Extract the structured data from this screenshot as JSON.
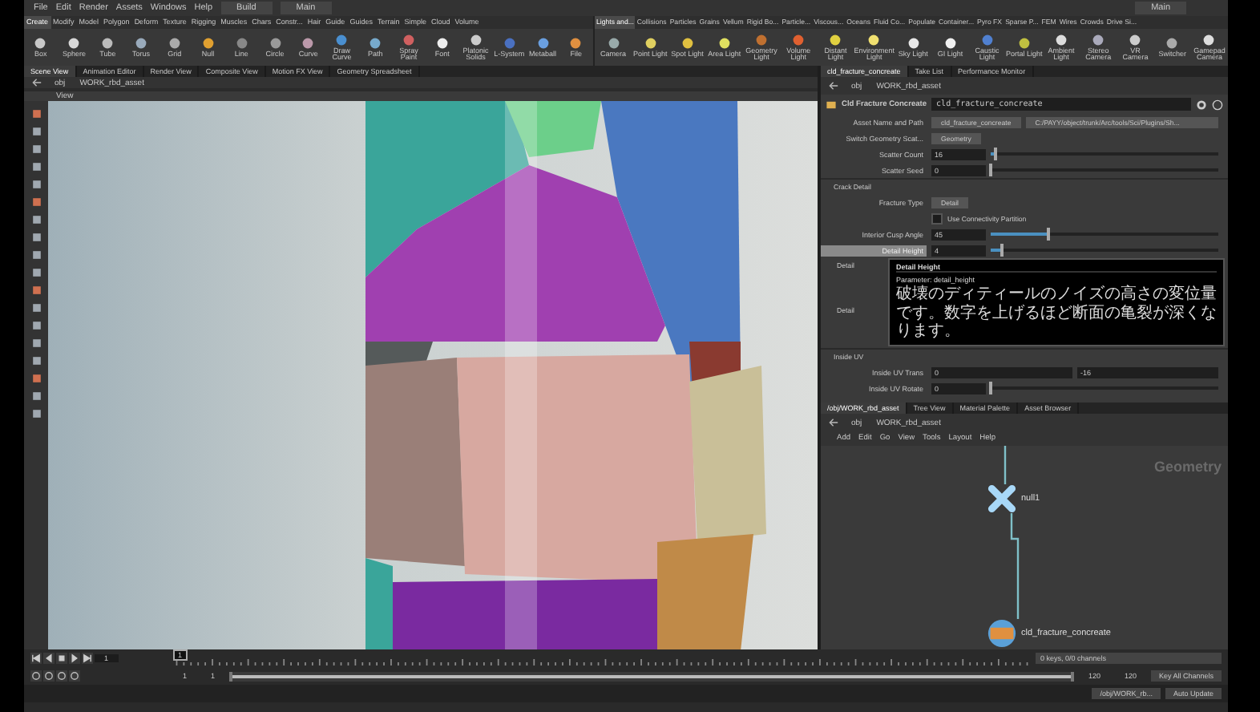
{
  "menu_bar": {
    "items": [
      "File",
      "Edit",
      "Render",
      "Assets",
      "Windows",
      "Help"
    ],
    "desktop": "Build",
    "context": "Main",
    "desktop_right": "Main"
  },
  "shelf_tabs": [
    {
      "label": "Create",
      "selected": true
    },
    {
      "label": "Modify",
      "selected": false
    },
    {
      "label": "Model",
      "selected": false
    },
    {
      "label": "Polygon",
      "selected": false
    },
    {
      "label": "Deform",
      "selected": false
    },
    {
      "label": "Texture",
      "selected": false
    },
    {
      "label": "Rigging",
      "selected": false
    },
    {
      "label": "Muscles",
      "selected": false
    },
    {
      "label": "Chars",
      "selected": false
    },
    {
      "label": "Constr...",
      "selected": false
    },
    {
      "label": "Hair",
      "selected": false
    },
    {
      "label": "Guide",
      "selected": false
    },
    {
      "label": "Guides",
      "selected": false
    },
    {
      "label": "Terrain",
      "selected": false
    },
    {
      "label": "Simple",
      "selected": false
    },
    {
      "label": "Cloud",
      "selected": false
    },
    {
      "label": "Volume",
      "selected": false
    }
  ],
  "shelf_tools": [
    "Box",
    "Sphere",
    "Tube",
    "Torus",
    "Grid",
    "Null",
    "Line",
    "Circle",
    "Curve",
    "Draw Curve",
    "Path",
    "Spray Paint",
    "Font",
    "Platonic Solids",
    "L-System",
    "Metaball",
    "File"
  ],
  "shelf_tabs_right": [
    {
      "label": "Lights and...",
      "selected": true
    },
    {
      "label": "Collisions",
      "selected": false
    },
    {
      "label": "Particles",
      "selected": false
    },
    {
      "label": "Grains",
      "selected": false
    },
    {
      "label": "Vellum",
      "selected": false
    },
    {
      "label": "Rigid Bo...",
      "selected": false
    },
    {
      "label": "Particle...",
      "selected": false
    },
    {
      "label": "Viscous...",
      "selected": false
    },
    {
      "label": "Oceans",
      "selected": false
    },
    {
      "label": "Fluid Co...",
      "selected": false
    },
    {
      "label": "Populate",
      "selected": false
    },
    {
      "label": "Container...",
      "selected": false
    },
    {
      "label": "Pyro FX",
      "selected": false
    },
    {
      "label": "Sparse P...",
      "selected": false
    },
    {
      "label": "FEM",
      "selected": false
    },
    {
      "label": "Wires",
      "selected": false
    },
    {
      "label": "Crowds",
      "selected": false
    },
    {
      "label": "Drive Si...",
      "selected": false
    }
  ],
  "shelf_tools_right": [
    "Camera",
    "Point Light",
    "Spot Light",
    "Area Light",
    "Geometry Light",
    "Volume Light",
    "Distant Light",
    "Environment Light",
    "Sky Light",
    "GI Light",
    "Caustic Light",
    "Portal Light",
    "Ambient Light",
    "Stereo Camera",
    "VR Camera",
    "Switcher",
    "Gamepad Camera"
  ],
  "left_pane": {
    "tabs": [
      {
        "label": "Scene View",
        "selected": true
      },
      {
        "label": "Animation Editor",
        "selected": false
      },
      {
        "label": "Render View",
        "selected": false
      },
      {
        "label": "Composite View",
        "selected": false
      },
      {
        "label": "Motion FX View",
        "selected": false
      },
      {
        "label": "Geometry Spreadsheet",
        "selected": false
      }
    ],
    "path": [
      "obj",
      "WORK_rbd_asset"
    ],
    "viewport_title": "View"
  },
  "parameter_pane": {
    "tabs": [
      {
        "label": "cld_fracture_concreate",
        "selected": true
      },
      {
        "label": "Take List",
        "selected": false
      },
      {
        "label": "Performance Monitor",
        "selected": false
      }
    ],
    "path": [
      "obj",
      "WORK_rbd_asset"
    ],
    "node_type": "Cld Fracture Concreate",
    "node_name": "cld_fracture_concreate",
    "asset_row": {
      "label": "Asset Name and Path",
      "name": "cld_fracture_concreate",
      "path": "C:/PAYY/object/trunk/Arc/tools/Sci/Plugins/Sh..."
    },
    "params": [
      {
        "kind": "menu",
        "label": "Switch Geometry Scat...",
        "value": "Geometry"
      },
      {
        "kind": "slider",
        "label": "Scatter Count",
        "value": "16",
        "level": 0.02
      },
      {
        "kind": "slider",
        "label": "Scatter Seed",
        "value": "0",
        "level": 0
      },
      {
        "kind": "section",
        "label": "Crack Detail"
      },
      {
        "kind": "menu",
        "label": "Fracture Type",
        "value": "Detail"
      },
      {
        "kind": "checkbox",
        "label": "Use Connectivity Partition",
        "checked": false
      },
      {
        "kind": "slider",
        "label": "Interior Cusp Angle",
        "value": "45",
        "level": 0.25
      },
      {
        "kind": "slider",
        "label": "Detail Height",
        "value": "4",
        "level": 0.05,
        "highlighted": true
      },
      {
        "kind": "covered",
        "label": "Detail"
      },
      {
        "kind": "covered",
        "label": "Detail"
      },
      {
        "kind": "section",
        "label": "Inside UV"
      },
      {
        "kind": "pair",
        "label": "Inside UV Trans",
        "value": "0",
        "value2": "-16"
      },
      {
        "kind": "slider",
        "label": "Inside UV Rotate",
        "value": "0",
        "level": 0
      }
    ],
    "tooltip": {
      "title": "Detail Height",
      "parameter": "Parameter: detail_height",
      "description": "破壊のディティールのノイズの高さの変位量です。数字を上げるほど断面の亀裂が深くなります。"
    }
  },
  "network_pane": {
    "tabs": [
      {
        "label": "/obj/WORK_rbd_asset",
        "selected": true
      },
      {
        "label": "Tree View",
        "selected": false
      },
      {
        "label": "Material Palette",
        "selected": false
      },
      {
        "label": "Asset Browser",
        "selected": false
      }
    ],
    "path": [
      "obj",
      "WORK_rbd_asset"
    ],
    "menu": [
      "Add",
      "Edit",
      "Go",
      "View",
      "Tools",
      "Layout",
      "Help"
    ],
    "context": "Geometry",
    "nodes": [
      {
        "kind": "null",
        "name": "null1"
      },
      {
        "kind": "asset",
        "name": "cld_fracture_concreate"
      }
    ]
  },
  "timeline": {
    "frame": "1",
    "marker": "1",
    "start": "1",
    "range_start": "1",
    "range_slider": {
      "level": 1
    },
    "range_end": "120",
    "end": "120",
    "keys": "0 keys, 0/0 channels",
    "key_all": "Key All Channels",
    "update": "Auto Update",
    "path": "/obj/WORK_rb..."
  }
}
